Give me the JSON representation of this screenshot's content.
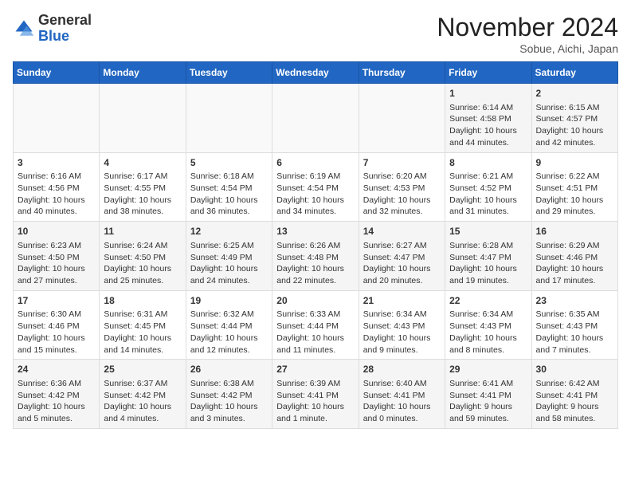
{
  "logo": {
    "general": "General",
    "blue": "Blue"
  },
  "header": {
    "month": "November 2024",
    "location": "Sobue, Aichi, Japan"
  },
  "weekdays": [
    "Sunday",
    "Monday",
    "Tuesday",
    "Wednesday",
    "Thursday",
    "Friday",
    "Saturday"
  ],
  "weeks": [
    [
      {
        "day": "",
        "content": ""
      },
      {
        "day": "",
        "content": ""
      },
      {
        "day": "",
        "content": ""
      },
      {
        "day": "",
        "content": ""
      },
      {
        "day": "",
        "content": ""
      },
      {
        "day": "1",
        "content": "Sunrise: 6:14 AM\nSunset: 4:58 PM\nDaylight: 10 hours and 44 minutes."
      },
      {
        "day": "2",
        "content": "Sunrise: 6:15 AM\nSunset: 4:57 PM\nDaylight: 10 hours and 42 minutes."
      }
    ],
    [
      {
        "day": "3",
        "content": "Sunrise: 6:16 AM\nSunset: 4:56 PM\nDaylight: 10 hours and 40 minutes."
      },
      {
        "day": "4",
        "content": "Sunrise: 6:17 AM\nSunset: 4:55 PM\nDaylight: 10 hours and 38 minutes."
      },
      {
        "day": "5",
        "content": "Sunrise: 6:18 AM\nSunset: 4:54 PM\nDaylight: 10 hours and 36 minutes."
      },
      {
        "day": "6",
        "content": "Sunrise: 6:19 AM\nSunset: 4:54 PM\nDaylight: 10 hours and 34 minutes."
      },
      {
        "day": "7",
        "content": "Sunrise: 6:20 AM\nSunset: 4:53 PM\nDaylight: 10 hours and 32 minutes."
      },
      {
        "day": "8",
        "content": "Sunrise: 6:21 AM\nSunset: 4:52 PM\nDaylight: 10 hours and 31 minutes."
      },
      {
        "day": "9",
        "content": "Sunrise: 6:22 AM\nSunset: 4:51 PM\nDaylight: 10 hours and 29 minutes."
      }
    ],
    [
      {
        "day": "10",
        "content": "Sunrise: 6:23 AM\nSunset: 4:50 PM\nDaylight: 10 hours and 27 minutes."
      },
      {
        "day": "11",
        "content": "Sunrise: 6:24 AM\nSunset: 4:50 PM\nDaylight: 10 hours and 25 minutes."
      },
      {
        "day": "12",
        "content": "Sunrise: 6:25 AM\nSunset: 4:49 PM\nDaylight: 10 hours and 24 minutes."
      },
      {
        "day": "13",
        "content": "Sunrise: 6:26 AM\nSunset: 4:48 PM\nDaylight: 10 hours and 22 minutes."
      },
      {
        "day": "14",
        "content": "Sunrise: 6:27 AM\nSunset: 4:47 PM\nDaylight: 10 hours and 20 minutes."
      },
      {
        "day": "15",
        "content": "Sunrise: 6:28 AM\nSunset: 4:47 PM\nDaylight: 10 hours and 19 minutes."
      },
      {
        "day": "16",
        "content": "Sunrise: 6:29 AM\nSunset: 4:46 PM\nDaylight: 10 hours and 17 minutes."
      }
    ],
    [
      {
        "day": "17",
        "content": "Sunrise: 6:30 AM\nSunset: 4:46 PM\nDaylight: 10 hours and 15 minutes."
      },
      {
        "day": "18",
        "content": "Sunrise: 6:31 AM\nSunset: 4:45 PM\nDaylight: 10 hours and 14 minutes."
      },
      {
        "day": "19",
        "content": "Sunrise: 6:32 AM\nSunset: 4:44 PM\nDaylight: 10 hours and 12 minutes."
      },
      {
        "day": "20",
        "content": "Sunrise: 6:33 AM\nSunset: 4:44 PM\nDaylight: 10 hours and 11 minutes."
      },
      {
        "day": "21",
        "content": "Sunrise: 6:34 AM\nSunset: 4:43 PM\nDaylight: 10 hours and 9 minutes."
      },
      {
        "day": "22",
        "content": "Sunrise: 6:34 AM\nSunset: 4:43 PM\nDaylight: 10 hours and 8 minutes."
      },
      {
        "day": "23",
        "content": "Sunrise: 6:35 AM\nSunset: 4:43 PM\nDaylight: 10 hours and 7 minutes."
      }
    ],
    [
      {
        "day": "24",
        "content": "Sunrise: 6:36 AM\nSunset: 4:42 PM\nDaylight: 10 hours and 5 minutes."
      },
      {
        "day": "25",
        "content": "Sunrise: 6:37 AM\nSunset: 4:42 PM\nDaylight: 10 hours and 4 minutes."
      },
      {
        "day": "26",
        "content": "Sunrise: 6:38 AM\nSunset: 4:42 PM\nDaylight: 10 hours and 3 minutes."
      },
      {
        "day": "27",
        "content": "Sunrise: 6:39 AM\nSunset: 4:41 PM\nDaylight: 10 hours and 1 minute."
      },
      {
        "day": "28",
        "content": "Sunrise: 6:40 AM\nSunset: 4:41 PM\nDaylight: 10 hours and 0 minutes."
      },
      {
        "day": "29",
        "content": "Sunrise: 6:41 AM\nSunset: 4:41 PM\nDaylight: 9 hours and 59 minutes."
      },
      {
        "day": "30",
        "content": "Sunrise: 6:42 AM\nSunset: 4:41 PM\nDaylight: 9 hours and 58 minutes."
      }
    ]
  ]
}
